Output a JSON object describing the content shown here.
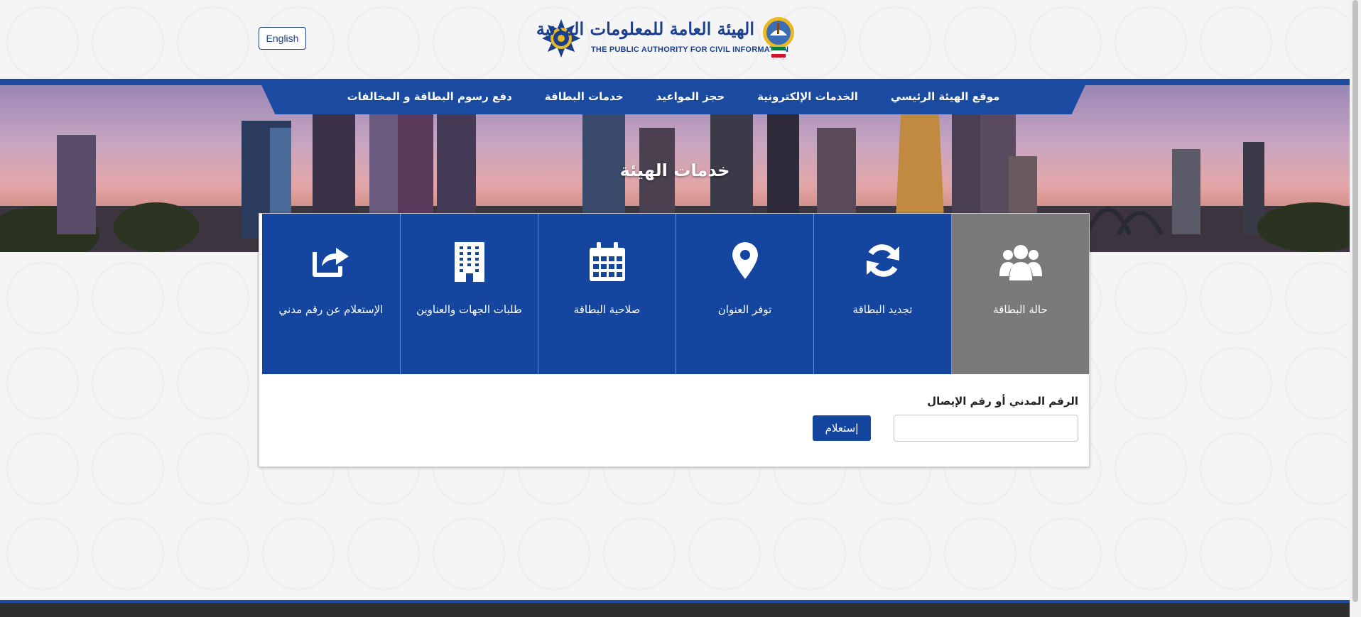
{
  "header": {
    "language_button": "English",
    "logo_ar": "الهيئة العامة للمعلومات المدنية",
    "logo_en": "THE PUBLIC AUTHORITY FOR CIVIL INFORMATION"
  },
  "nav": {
    "items": [
      "موقع الهيئة الرئيسي",
      "الخدمات الإلكترونية",
      "حجز المواعيد",
      "خدمات البطاقة",
      "دفع رسوم البطاقة و المخالفات"
    ]
  },
  "hero": {
    "title": "خدمات الهيئة"
  },
  "services": {
    "tiles": [
      {
        "label": "حالة البطاقة",
        "icon": "users-icon",
        "active": true
      },
      {
        "label": "تجديد البطاقة",
        "icon": "refresh-icon",
        "active": false
      },
      {
        "label": "توفر العنوان",
        "icon": "map-marker-icon",
        "active": false
      },
      {
        "label": "صلاحية البطاقة",
        "icon": "calendar-icon",
        "active": false
      },
      {
        "label": "طلبات الجهات والعناوين",
        "icon": "building-icon",
        "active": false
      },
      {
        "label": "الإستعلام عن رقم مدني",
        "icon": "share-icon",
        "active": false
      }
    ]
  },
  "form": {
    "label": "الرقم المدني أو رقم الإيصال",
    "input_value": "",
    "submit_label": "إستعلام"
  },
  "colors": {
    "primary": "#1446a0",
    "active_tile": "#7a7a7a",
    "footer": "#2e2e2e"
  }
}
